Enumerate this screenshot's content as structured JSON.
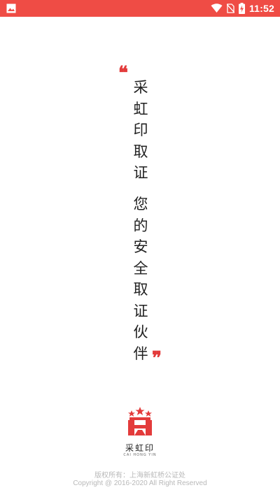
{
  "status_bar": {
    "time": "11:52",
    "icons": [
      "gallery-icon",
      "wifi-icon",
      "no-sim-icon",
      "battery-charging-icon"
    ],
    "color": "#ef4c45"
  },
  "splash": {
    "quote_open": "❝",
    "quote_close": "❞",
    "line1": [
      "采",
      "虹",
      "印",
      "取",
      "证"
    ],
    "line2": [
      "您",
      "的",
      "安",
      "全",
      "取",
      "证",
      "伙",
      "伴"
    ],
    "accent_color": "#e33b3b"
  },
  "logo": {
    "name": "采虹印",
    "pinyin": "CAI HONG YIN"
  },
  "footer": {
    "copyright_cn": "版权所有：上海新虹桥公证处",
    "copyright_en": "Copyright @ 2016-2020 All Right Reserved"
  }
}
